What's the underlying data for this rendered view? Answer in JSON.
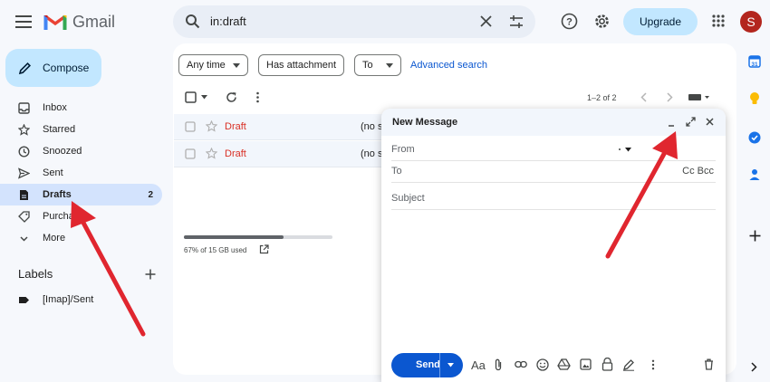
{
  "app": {
    "name": "Gmail"
  },
  "header": {
    "search_value": "in:draft",
    "upgrade_label": "Upgrade",
    "avatar_initial": "S"
  },
  "sidebar": {
    "compose_label": "Compose",
    "items": [
      {
        "label": "Inbox",
        "count": "",
        "icon": "inbox-icon"
      },
      {
        "label": "Starred",
        "count": "",
        "icon": "star-icon"
      },
      {
        "label": "Snoozed",
        "count": "",
        "icon": "clock-icon"
      },
      {
        "label": "Sent",
        "count": "",
        "icon": "send-icon"
      },
      {
        "label": "Drafts",
        "count": "2",
        "icon": "draft-icon"
      },
      {
        "label": "Purcha",
        "count": "",
        "icon": "tag-icon"
      },
      {
        "label": "More",
        "count": "",
        "icon": "chevron-down-icon"
      }
    ],
    "labels_title": "Labels",
    "labels": [
      {
        "label": "[Imap]/Sent",
        "icon": "label-icon"
      }
    ]
  },
  "filters": {
    "chips": [
      "Any time",
      "Has attachment",
      "To"
    ],
    "advanced_search": "Advanced search"
  },
  "toolbar": {
    "pagination": "1–2 of 2"
  },
  "list": {
    "rows": [
      {
        "sender": "Draft",
        "subject": "(no s"
      },
      {
        "sender": "Draft",
        "subject": "(no s"
      }
    ]
  },
  "storage": {
    "text": "67% of 15 GB used",
    "fraction": 0.67
  },
  "compose_window": {
    "title": "New Message",
    "from_label": "From",
    "to_label": "To",
    "cc_bcc": "Cc Bcc",
    "subject_placeholder": "Subject",
    "send_label": "Send"
  },
  "colors": {
    "accent": "#0b57d0",
    "compose_bg": "#c2e7ff",
    "draft_red": "#d93025",
    "arrow": "#e0262f"
  }
}
